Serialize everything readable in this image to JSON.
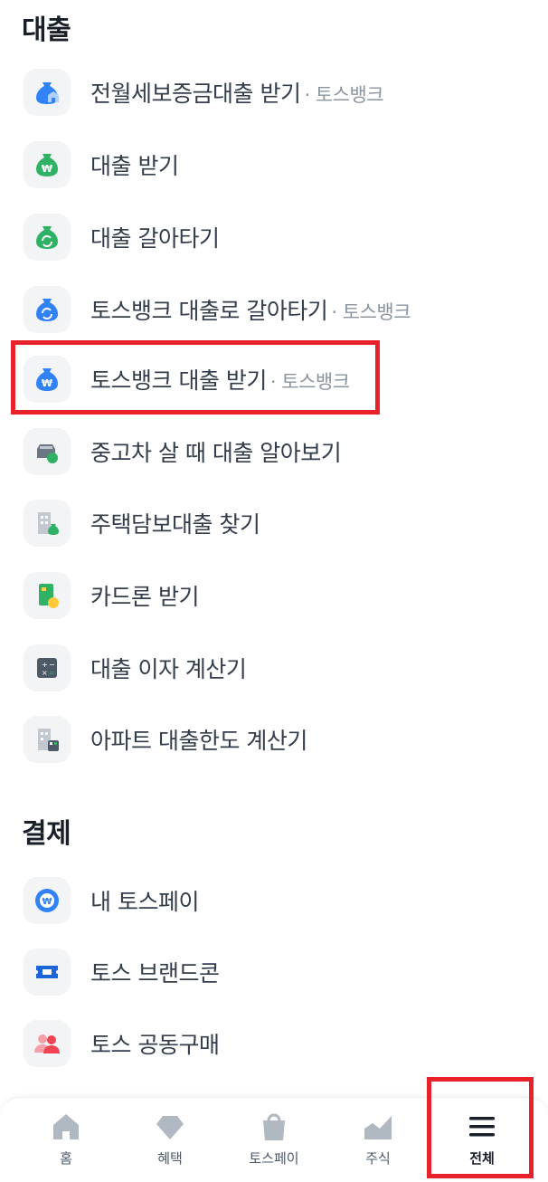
{
  "sections": {
    "loan": {
      "title": "대출",
      "items": [
        {
          "label": "전월세보증금대출 받기",
          "sub": "· 토스뱅크"
        },
        {
          "label": "대출 받기",
          "sub": ""
        },
        {
          "label": "대출 갈아타기",
          "sub": ""
        },
        {
          "label": "토스뱅크 대출로 갈아타기",
          "sub": "· 토스뱅크"
        },
        {
          "label": "토스뱅크 대출 받기",
          "sub": "· 토스뱅크"
        },
        {
          "label": "중고차 살 때 대출 알아보기",
          "sub": ""
        },
        {
          "label": "주택담보대출 찾기",
          "sub": ""
        },
        {
          "label": "카드론 받기",
          "sub": ""
        },
        {
          "label": "대출 이자 계산기",
          "sub": ""
        },
        {
          "label": "아파트 대출한도 계산기",
          "sub": ""
        }
      ]
    },
    "payment": {
      "title": "결제",
      "items": [
        {
          "label": "내 토스페이",
          "sub": ""
        },
        {
          "label": "토스 브랜드콘",
          "sub": ""
        },
        {
          "label": "토스 공동구매",
          "sub": ""
        }
      ]
    }
  },
  "tabbar": {
    "home": "홈",
    "benefits": "혜택",
    "tosspay": "토스페이",
    "stocks": "주식",
    "all": "전체"
  },
  "colors": {
    "highlight": "#e8212b",
    "blue": "#3182f6",
    "green": "#2fb266",
    "text": "#333d4b",
    "subtext": "#8b95a1",
    "tab_icon": "#b0b8c1"
  }
}
